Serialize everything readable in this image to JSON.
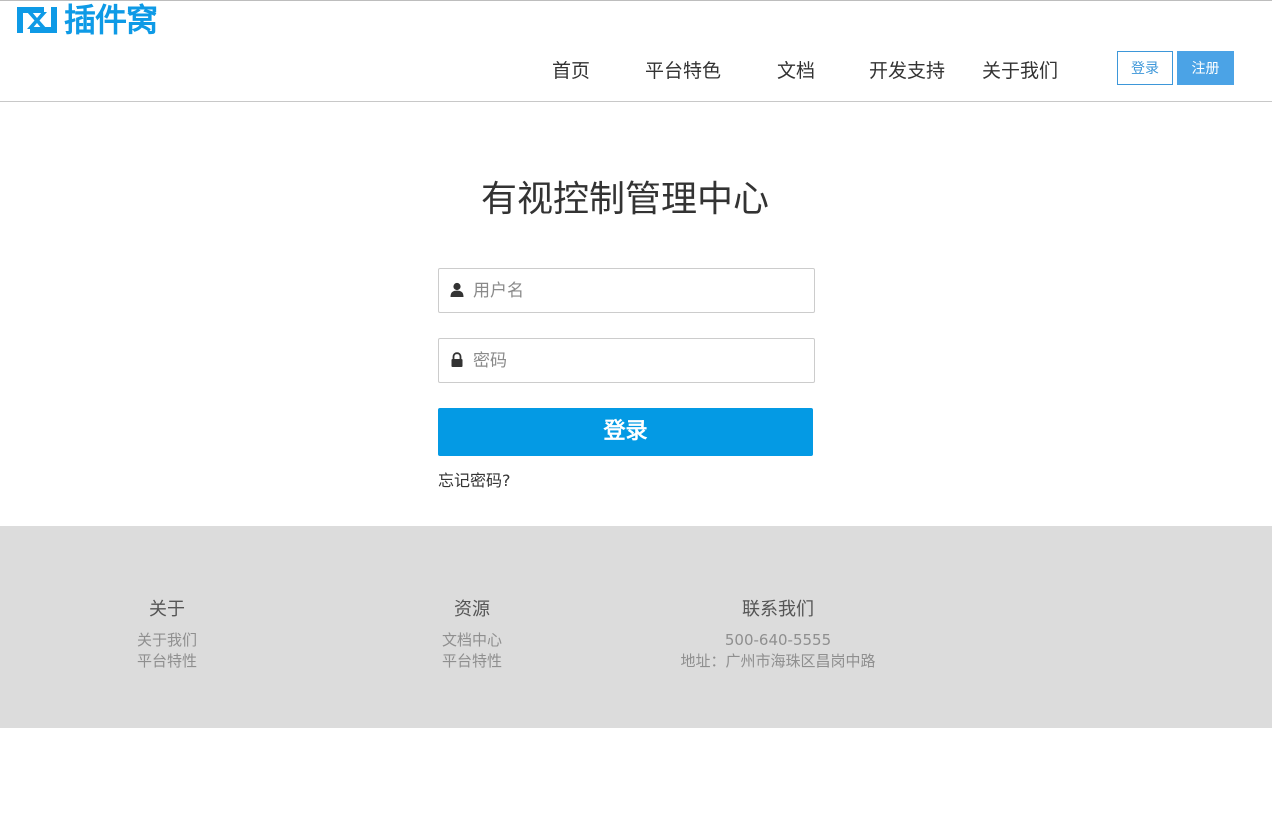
{
  "header": {
    "logo_text": "插件窝",
    "nav": [
      {
        "label": "首页"
      },
      {
        "label": "平台特色"
      },
      {
        "label": "文档"
      },
      {
        "label": "开发支持"
      },
      {
        "label": "关于我们"
      }
    ],
    "login_label": "登录",
    "register_label": "注册"
  },
  "main": {
    "title": "有视控制管理中心",
    "username": {
      "placeholder": "用户名",
      "value": "",
      "icon": "user-icon"
    },
    "password": {
      "placeholder": "密码",
      "value": "",
      "icon": "lock-icon"
    },
    "submit_label": "登录",
    "forgot_label": "忘记密码?"
  },
  "footer": {
    "columns": [
      {
        "heading": "关于",
        "links": [
          "关于我们",
          "平台特性"
        ]
      },
      {
        "heading": "资源",
        "links": [
          "文档中心",
          "平台特性"
        ]
      },
      {
        "heading": "联系我们",
        "links": [
          "500-640-5555",
          "地址：广州市海珠区昌岗中路"
        ]
      }
    ]
  },
  "colors": {
    "brand": "#0e9ae6",
    "primary_button": "#049ae4",
    "register_button": "#4ba3e6",
    "footer_bg": "#dcdcdc"
  }
}
